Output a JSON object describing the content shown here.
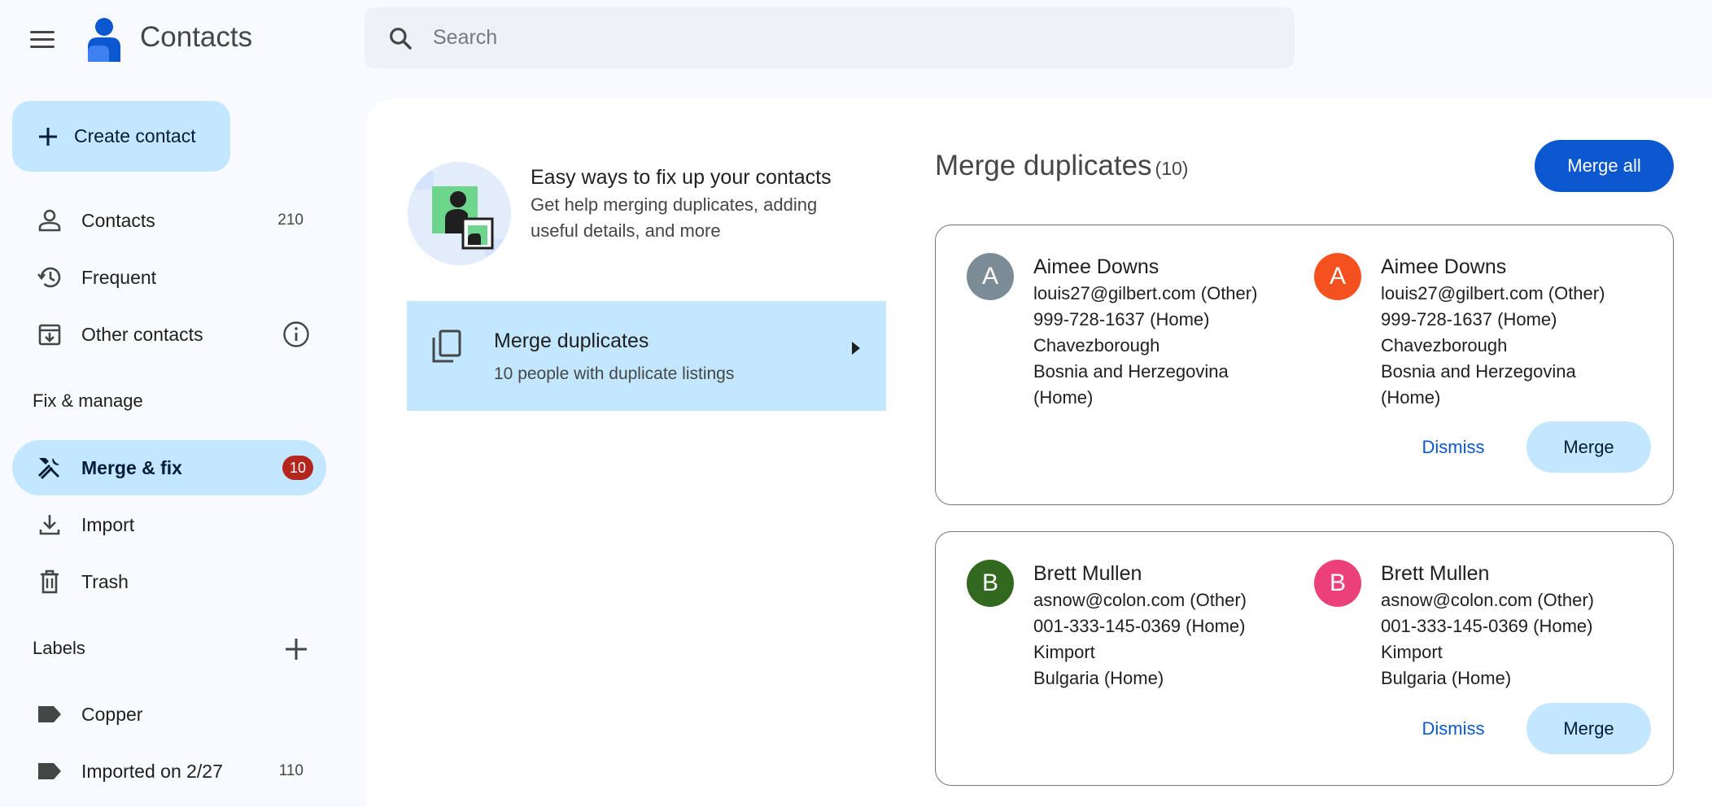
{
  "app": {
    "title": "Contacts"
  },
  "search": {
    "placeholder": "Search",
    "value": ""
  },
  "sidebar": {
    "create_label": "Create contact",
    "items": [
      {
        "label": "Contacts",
        "count": "210"
      },
      {
        "label": "Frequent",
        "count": ""
      },
      {
        "label": "Other contacts",
        "count": ""
      }
    ],
    "fix_header": "Fix & manage",
    "fix_items": [
      {
        "label": "Merge & fix",
        "badge": "10"
      },
      {
        "label": "Import"
      },
      {
        "label": "Trash"
      }
    ],
    "labels_header": "Labels",
    "labels": [
      {
        "label": "Copper",
        "count": ""
      },
      {
        "label": "Imported on 2/27",
        "count": "110"
      }
    ]
  },
  "fixup": {
    "title": "Easy ways to fix up your contacts",
    "subtitle": "Get help merging duplicates, adding useful details, and more",
    "merge_nav_title": "Merge duplicates",
    "merge_nav_sub": "10 people with duplicate listings"
  },
  "merge": {
    "title": "Merge duplicates",
    "count": "(10)",
    "merge_all_label": "Merge all",
    "dismiss_label": "Dismiss",
    "merge_label": "Merge",
    "pairs": [
      {
        "left": {
          "initial": "A",
          "color": "#7b8c97",
          "name": "Aimee Downs",
          "email": "louis27@gilbert.com (Other)",
          "phone": "999-728-1637 (Home)",
          "city": "Chavezborough",
          "country": "Bosnia and Herzegovina",
          "country_type": "(Home)"
        },
        "right": {
          "initial": "A",
          "color": "#f4511e",
          "name": "Aimee Downs",
          "email": "louis27@gilbert.com (Other)",
          "phone": "999-728-1637 (Home)",
          "city": "Chavezborough",
          "country": "Bosnia and Herzegovina",
          "country_type": "(Home)"
        }
      },
      {
        "left": {
          "initial": "B",
          "color": "#33691e",
          "name": "Brett Mullen",
          "email": "asnow@colon.com (Other)",
          "phone": "001-333-145-0369 (Home)",
          "city": "Kimport",
          "country": "Bulgaria (Home)"
        },
        "right": {
          "initial": "B",
          "color": "#ec407a",
          "name": "Brett Mullen",
          "email": "asnow@colon.com (Other)",
          "phone": "001-333-145-0369 (Home)",
          "city": "Kimport",
          "country": "Bulgaria (Home)"
        }
      }
    ]
  }
}
